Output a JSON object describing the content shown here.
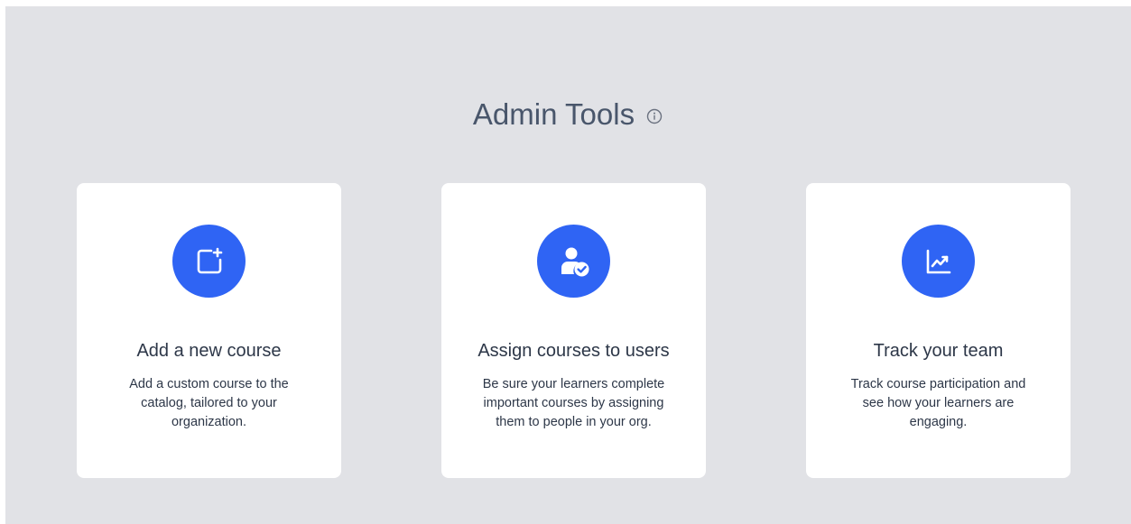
{
  "header": {
    "title": "Admin Tools",
    "info_icon": "info-circle-icon"
  },
  "colors": {
    "background": "#e1e2e6",
    "card": "#ffffff",
    "accent": "#2f64f4",
    "title_text": "#49566b",
    "body_text": "#2d3748"
  },
  "cards": [
    {
      "icon": "add-course-icon",
      "title": "Add a new course",
      "description": "Add a custom course to the catalog, tailored to your organization."
    },
    {
      "icon": "assign-user-icon",
      "title": "Assign courses to users",
      "description": "Be sure your learners complete important courses by assigning them to people in your org."
    },
    {
      "icon": "chart-trend-icon",
      "title": "Track your team",
      "description": "Track course participation and see how your learners are engaging."
    }
  ]
}
